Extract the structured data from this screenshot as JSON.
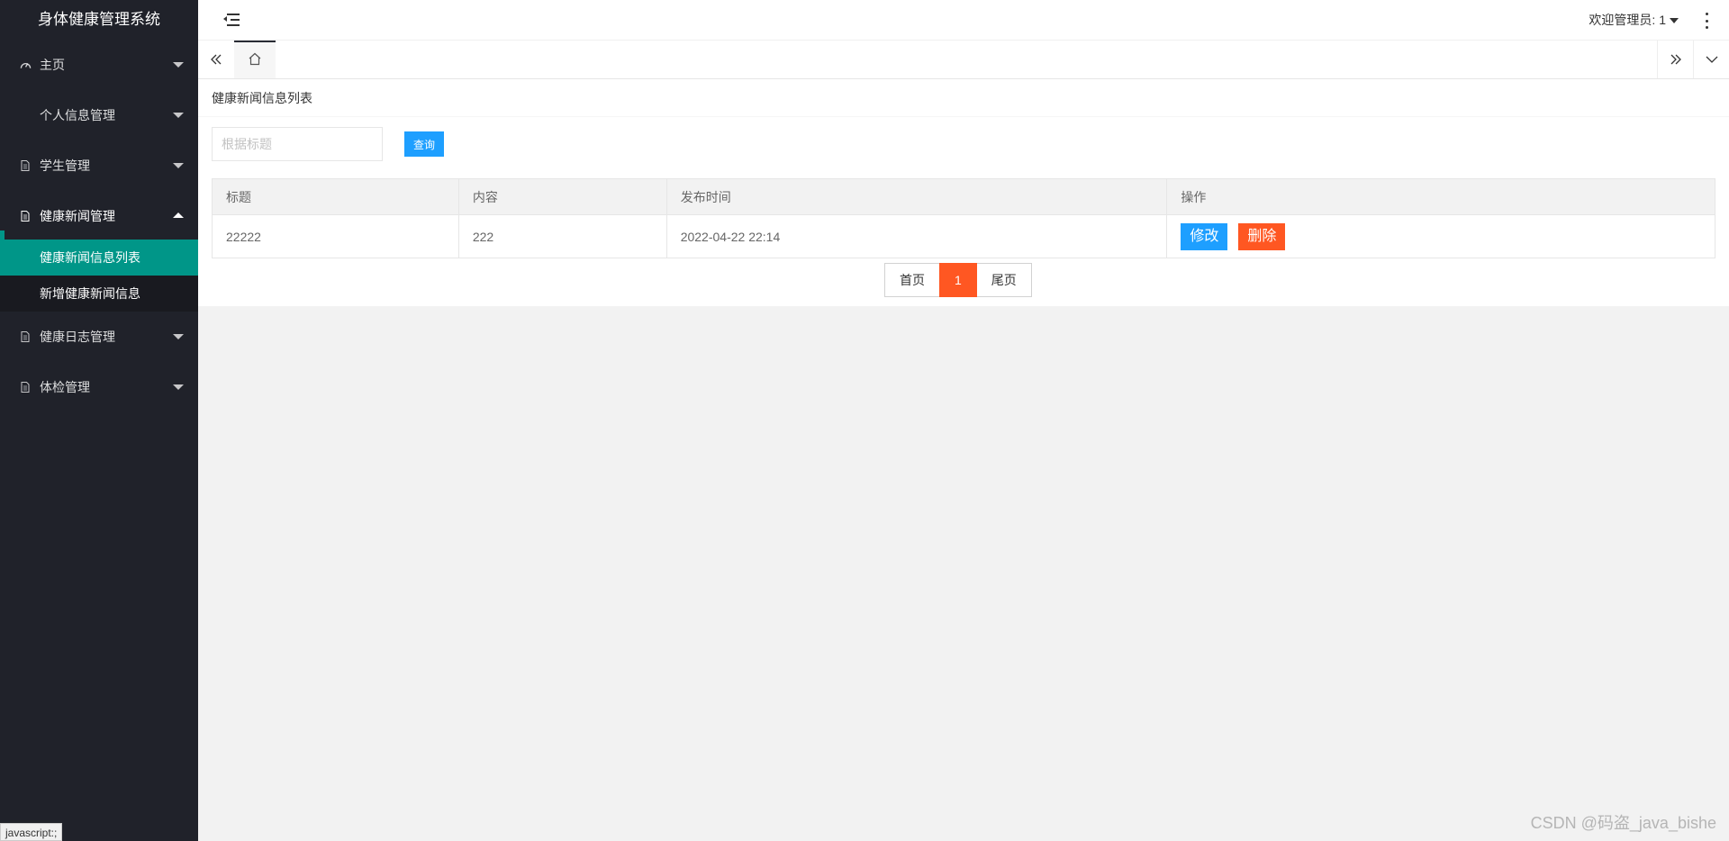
{
  "app": {
    "title": "身体健康管理系统"
  },
  "sidebar": {
    "items": [
      {
        "label": "主页",
        "icon": "dashboard-icon"
      },
      {
        "label": "个人信息管理",
        "icon": ""
      },
      {
        "label": "学生管理",
        "icon": "file-icon"
      },
      {
        "label": "健康新闻管理",
        "icon": "file-icon",
        "expanded": true,
        "children": [
          {
            "label": "健康新闻信息列表",
            "active": true
          },
          {
            "label": "新增健康新闻信息"
          }
        ]
      },
      {
        "label": "健康日志管理",
        "icon": "file-icon"
      },
      {
        "label": "体检管理",
        "icon": "file-icon"
      }
    ]
  },
  "header": {
    "welcome": "欢迎管理员: 1"
  },
  "card": {
    "title": "健康新闻信息列表",
    "search": {
      "placeholder": "根据标题",
      "value": "",
      "button": "查询"
    },
    "table": {
      "columns": [
        "标题",
        "内容",
        "发布时间",
        "操作"
      ],
      "rows": [
        {
          "title": "22222",
          "content": "222",
          "time": "2022-04-22 22:14",
          "edit": "修改",
          "delete": "删除"
        }
      ]
    },
    "pager": {
      "first": "首页",
      "current": "1",
      "last": "尾页"
    }
  },
  "status_bar": {
    "text": "javascript:;"
  },
  "watermark": "CSDN @码盗_java_bishe",
  "colors": {
    "sidebar_bg": "#20222a",
    "active": "#009688",
    "primary": "#1e9fff",
    "danger": "#ff5722"
  }
}
